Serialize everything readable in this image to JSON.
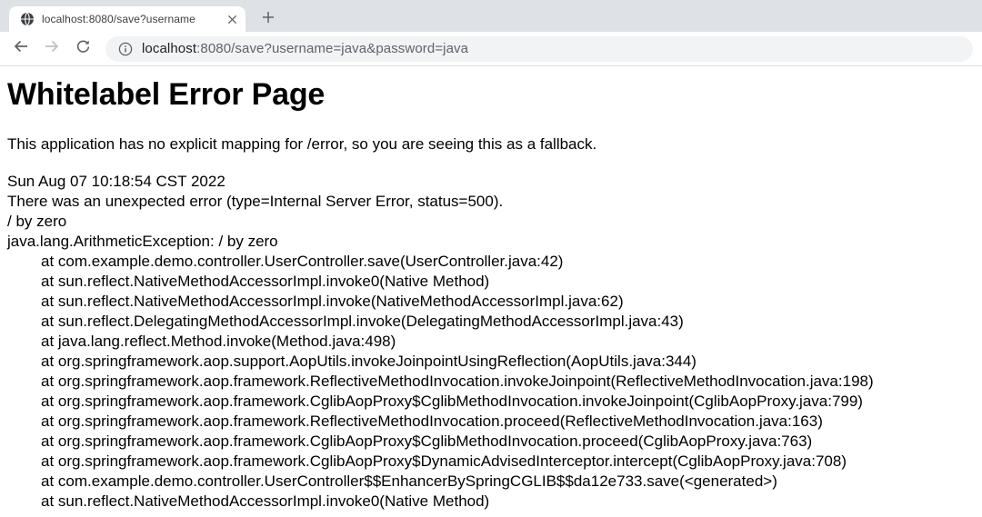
{
  "browser": {
    "tab": {
      "title": "localhost:8080/save?username",
      "favicon_icon": "globe-icon",
      "close_icon": "close-icon",
      "new_tab_icon": "plus-icon"
    },
    "toolbar": {
      "back_icon": "arrow-left-icon",
      "forward_icon": "arrow-right-icon",
      "reload_icon": "reload-icon",
      "site_info_icon": "info-icon",
      "url": {
        "host": "localhost",
        "rest": ":8080/save?username=java&password=java"
      }
    },
    "colors": {
      "tab_strip_bg": "#dee1e6",
      "toolbar_bg": "#ffffff",
      "omnibox_bg": "#f1f3f4",
      "icon_gray": "#5f6368",
      "icon_disabled": "#bdc1c6",
      "url_host_color": "#202124",
      "url_rest_color": "#5f6368"
    }
  },
  "page": {
    "title": "Whitelabel Error Page",
    "intro": "This application has no explicit mapping for /error, so you are seeing this as a fallback.",
    "timestamp": "Sun Aug 07 10:18:54 CST 2022",
    "error_message": "There was an unexpected error (type=Internal Server Error, status=500).",
    "exception_message": "/ by zero",
    "exception_line": "java.lang.ArithmeticException: / by zero",
    "stack_trace": [
      "at com.example.demo.controller.UserController.save(UserController.java:42)",
      "at sun.reflect.NativeMethodAccessorImpl.invoke0(Native Method)",
      "at sun.reflect.NativeMethodAccessorImpl.invoke(NativeMethodAccessorImpl.java:62)",
      "at sun.reflect.DelegatingMethodAccessorImpl.invoke(DelegatingMethodAccessorImpl.java:43)",
      "at java.lang.reflect.Method.invoke(Method.java:498)",
      "at org.springframework.aop.support.AopUtils.invokeJoinpointUsingReflection(AopUtils.java:344)",
      "at org.springframework.aop.framework.ReflectiveMethodInvocation.invokeJoinpoint(ReflectiveMethodInvocation.java:198)",
      "at org.springframework.aop.framework.CglibAopProxy$CglibMethodInvocation.invokeJoinpoint(CglibAopProxy.java:799)",
      "at org.springframework.aop.framework.ReflectiveMethodInvocation.proceed(ReflectiveMethodInvocation.java:163)",
      "at org.springframework.aop.framework.CglibAopProxy$CglibMethodInvocation.proceed(CglibAopProxy.java:763)",
      "at org.springframework.aop.framework.CglibAopProxy$DynamicAdvisedInterceptor.intercept(CglibAopProxy.java:708)",
      "at com.example.demo.controller.UserController$$EnhancerBySpringCGLIB$$da12e733.save(<generated>)",
      "at sun.reflect.NativeMethodAccessorImpl.invoke0(Native Method)"
    ]
  }
}
